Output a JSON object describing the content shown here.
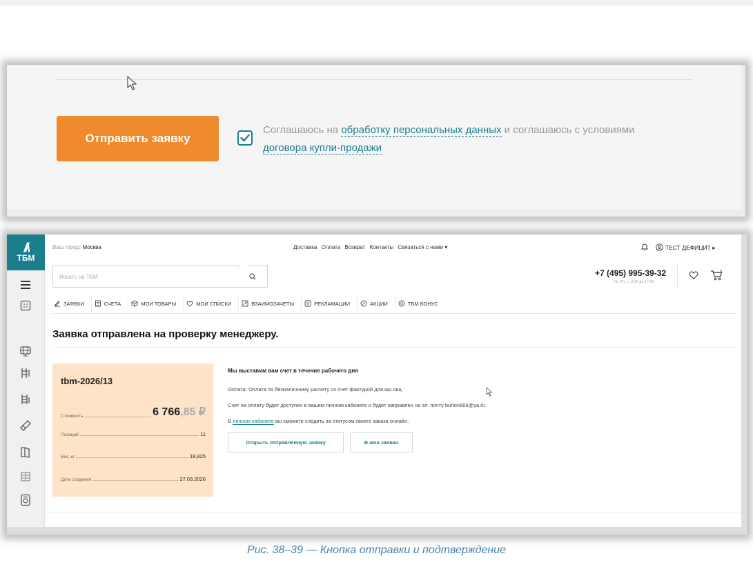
{
  "shot1": {
    "submit_label": "Отправить заявку",
    "consent_prefix": "Соглашаюсь на ",
    "consent_link1": "обработку персональных данных",
    "consent_middle": " и соглашаюсь с условиями ",
    "consent_link2": "договора купли-продажи",
    "checkbox_checked": true
  },
  "header": {
    "logo_text": "ТБМ",
    "city_label": "Ваш город: ",
    "city": "Москва",
    "nav": [
      "Доставка",
      "Оплата",
      "Возврат",
      "Контакты",
      "Связаться с нами ▾"
    ],
    "user": "ТЕСТ ДЕФИЦИТ ▸",
    "search_placeholder": "Искать на ТБМ",
    "phone": "+7 (495) 995-39-32",
    "hours": "Пн.-Пт.: с 8:00 до 17:00"
  },
  "tabs": [
    {
      "icon": "edit-icon",
      "label": "ЗАЯВКИ"
    },
    {
      "icon": "invoice-icon",
      "label": "СЧЕТА"
    },
    {
      "icon": "box-icon",
      "label": "МОИ ТОВАРЫ"
    },
    {
      "icon": "heart-icon",
      "label": "МОИ СПИСКИ"
    },
    {
      "icon": "exchange-icon",
      "label": "ВЗАИМОЗАЧЕТЫ"
    },
    {
      "icon": "claim-icon",
      "label": "РЕКЛАМАЦИИ"
    },
    {
      "icon": "percent-icon",
      "label": "АКЦИИ"
    },
    {
      "icon": "bonus-icon",
      "label": "ТБМ БОНУС"
    }
  ],
  "main": {
    "title": "Заявка отправлена на проверку менеджеру.",
    "card": {
      "number": "tbm-2026/13",
      "cost_label": "Стоимость",
      "cost_int": "6 766",
      "cost_frac": ",85 ₽",
      "positions_label": "Позиций",
      "positions": "11",
      "weight_label": "Вес, кг",
      "weight": "18,825",
      "date_label": "Дата создания",
      "date": "27.03.2026"
    },
    "info_title": "Мы выставим вам счет в течение рабочего дня",
    "payment": "Оплата: Оплата по безналичному расчету со счет-фактурой для юр.лиц",
    "invoice_note": "Счет на оплату будет доступен в вашем личном кабинете и будет направлен на эл. почту burton686@ya.ru",
    "track_prefix": "В ",
    "track_link": "личном кабинете",
    "track_suffix": " вы сможете следить за статусом своего заказа онлайн.",
    "btn_open": "Открыть отправленную заявку",
    "btn_my": "В мои заявки"
  },
  "caption": "Рис. 38–39 — Кнопка отправки и подтверждение",
  "colors": {
    "accent_orange": "#f08a2e",
    "brand_teal": "#1b7e8d",
    "card_bg": "#fde3c8"
  }
}
